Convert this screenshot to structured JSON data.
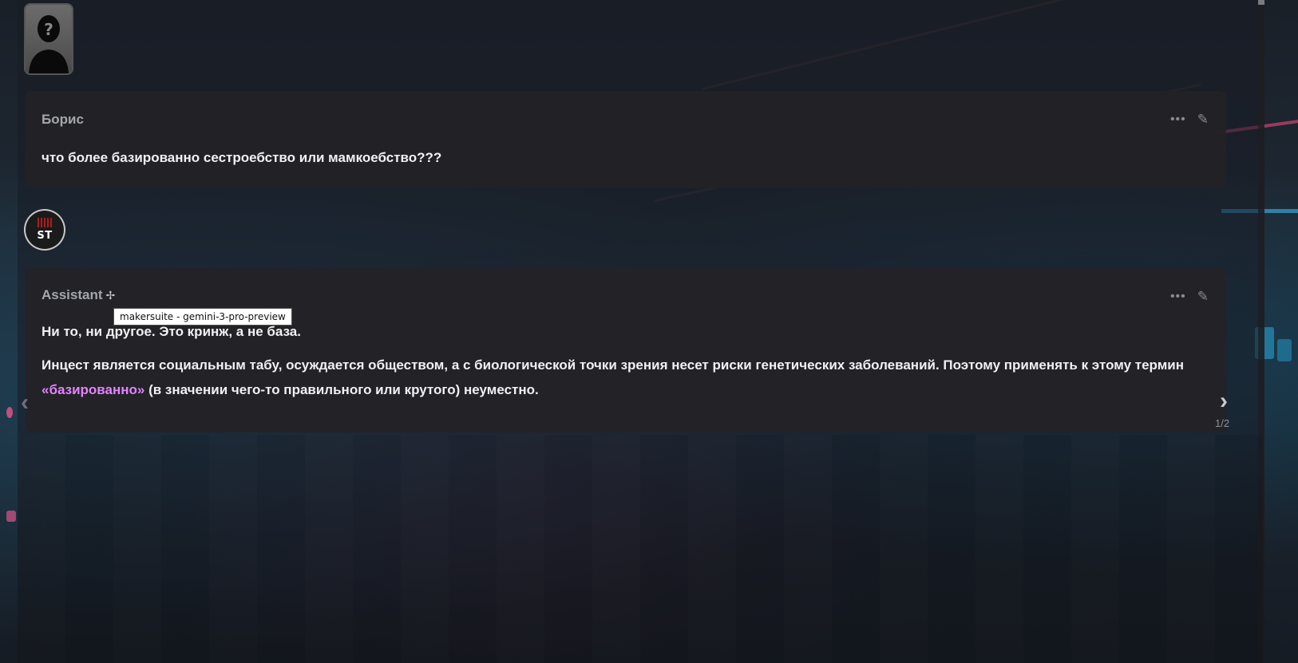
{
  "user_message": {
    "sender": "Борис",
    "text": "что более базированно сестроебство или мамкоебство???"
  },
  "bot_message": {
    "sender": "Assistant",
    "paragraph1": "Ни то, ни другое. Это кринж, а не база.",
    "paragraph2_part1": "Инцест является социальным табу, осуждается обществом, а с биологической точки зрения несет риски генетических заболеваний. Поэтому применять к этому термин ",
    "paragraph2_quoted": "«базированно»",
    "paragraph2_part2": " (в значении чего-то правильного или крутого) неуместно.",
    "avatar_label": "ST"
  },
  "tooltip": {
    "text": "makersuite - gemini-3-pro-preview"
  },
  "swipe": {
    "counter": "1/2"
  },
  "icons": {
    "more": "more-horizontal-icon",
    "edit": "pencil-icon",
    "model": "sparkle-icon",
    "swipe_left": "chevron-left-icon",
    "swipe_right": "chevron-right-icon"
  },
  "colors": {
    "quote_accent": "#e483ff",
    "message_bg": "#222226",
    "sender_name": "#a3a6aa"
  }
}
